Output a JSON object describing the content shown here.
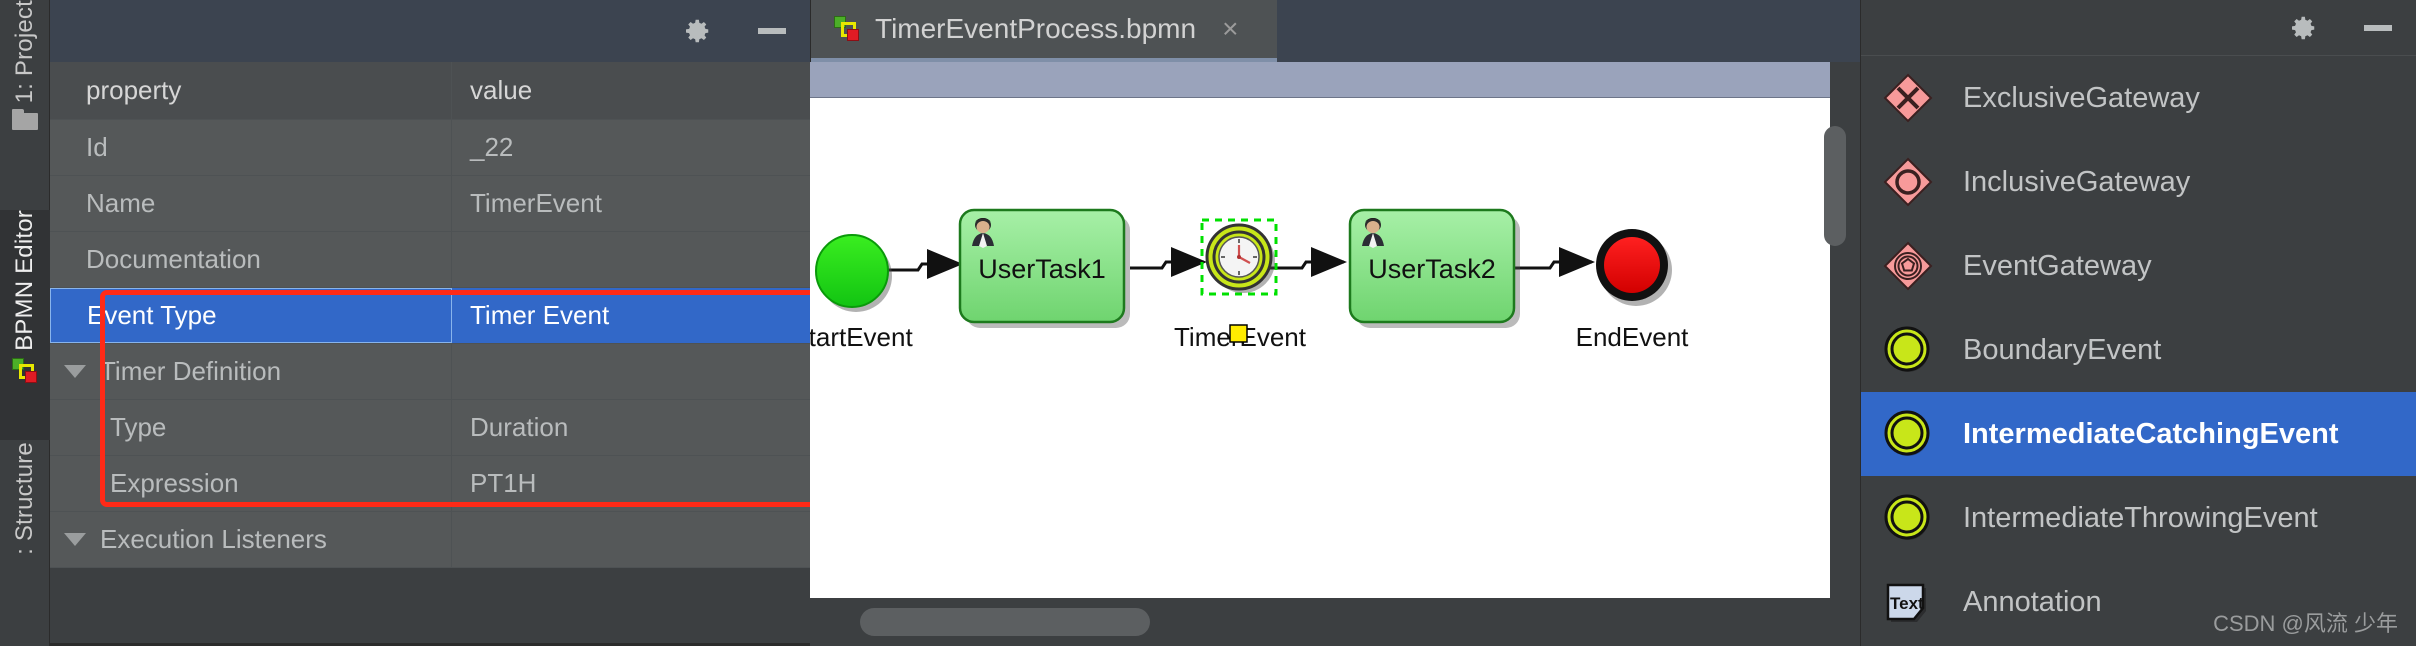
{
  "tool_strip": {
    "items": [
      {
        "label": "1: Project",
        "icon": "folder-icon"
      },
      {
        "label": "BPMN Editor",
        "icon": "bpmn-squares-icon"
      },
      {
        "label": ": Structure",
        "icon": "none"
      }
    ]
  },
  "properties_panel": {
    "titlebar": {
      "settings_icon": "gear-icon",
      "minimize_icon": "minimize-icon"
    },
    "columns": {
      "property": "property",
      "value": "value"
    },
    "rows": [
      {
        "name": "Id",
        "value": "_22",
        "kind": "leaf",
        "selected": false,
        "indent": 0
      },
      {
        "name": "Name",
        "value": "TimerEvent",
        "kind": "leaf",
        "selected": false,
        "indent": 0
      },
      {
        "name": "Documentation",
        "value": "",
        "kind": "leaf",
        "selected": false,
        "indent": 0
      },
      {
        "name": "Event Type",
        "value": "Timer Event",
        "kind": "leaf",
        "selected": true,
        "indent": 0
      },
      {
        "name": "Timer Definition",
        "value": "",
        "kind": "group",
        "selected": false,
        "indent": 0
      },
      {
        "name": "Type",
        "value": "Duration",
        "kind": "leaf",
        "selected": false,
        "indent": 1
      },
      {
        "name": "Expression",
        "value": "PT1H",
        "kind": "leaf",
        "selected": false,
        "indent": 1
      },
      {
        "name": "Execution Listeners",
        "value": "",
        "kind": "group",
        "selected": false,
        "indent": 0
      }
    ],
    "highlight_color": "#ff2a17"
  },
  "editor": {
    "tab": {
      "title": "TimerEventProcess.bpmn",
      "close_label": "×",
      "icon": "bpmn-squares-icon"
    },
    "diagram": {
      "nodes": [
        {
          "id": "start",
          "type": "start-event",
          "label": "StartEvent",
          "color": "#22dd22"
        },
        {
          "id": "ut1",
          "type": "user-task",
          "label": "UserTask1",
          "color": "#8ce68c"
        },
        {
          "id": "timer",
          "type": "intermediate-catching-timer-event",
          "label": "TimerEvent",
          "color": "#c8e619",
          "selected": true
        },
        {
          "id": "ut2",
          "type": "user-task",
          "label": "UserTask2",
          "color": "#8ce68c"
        },
        {
          "id": "end",
          "type": "end-event",
          "label": "EndEvent",
          "color": "#ee0000"
        }
      ],
      "flows": [
        {
          "from": "start",
          "to": "ut1"
        },
        {
          "from": "ut1",
          "to": "timer"
        },
        {
          "from": "timer",
          "to": "ut2"
        },
        {
          "from": "ut2",
          "to": "end"
        }
      ]
    }
  },
  "palette": {
    "titlebar": {
      "settings_icon": "gear-icon",
      "minimize_icon": "minimize-icon"
    },
    "items": [
      {
        "label": "ExclusiveGateway",
        "icon": "exclusive-gateway-icon",
        "selected": false
      },
      {
        "label": "InclusiveGateway",
        "icon": "inclusive-gateway-icon",
        "selected": false
      },
      {
        "label": "EventGateway",
        "icon": "event-gateway-icon",
        "selected": false
      },
      {
        "label": "BoundaryEvent",
        "icon": "boundary-event-icon",
        "selected": false
      },
      {
        "label": "IntermediateCatchingEvent",
        "icon": "intermediate-catching-event-icon",
        "selected": true
      },
      {
        "label": "IntermediateThrowingEvent",
        "icon": "intermediate-throwing-event-icon",
        "selected": false
      },
      {
        "label": "Annotation",
        "icon": "text-annotation-icon",
        "selected": false
      }
    ],
    "selected_color": "#3268c8"
  },
  "watermark": {
    "text": "CSDN @风流 少年"
  }
}
